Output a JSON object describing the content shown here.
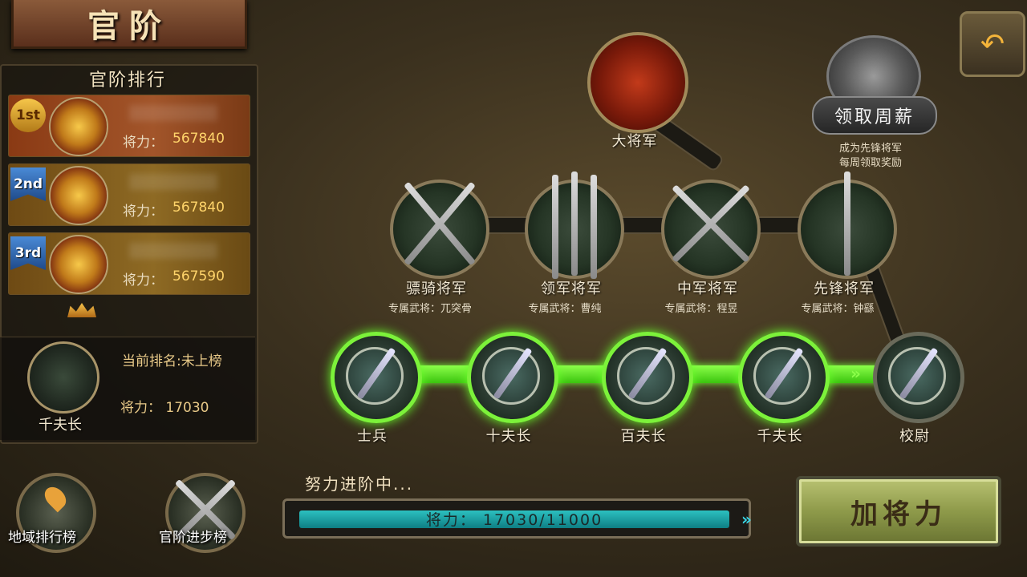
{
  "page_title": "官阶",
  "ranking": {
    "header": "官阶排行",
    "power_label": "将力：",
    "rows": [
      {
        "badge": "1st",
        "power": "567840"
      },
      {
        "badge": "2nd",
        "power": "567840"
      },
      {
        "badge": "3rd",
        "power": "567590"
      }
    ]
  },
  "current": {
    "rank_text": "当前排名:未上榜",
    "power_text": "将力：  17030",
    "title": "千夫长"
  },
  "weekly": {
    "button": "领取周薪",
    "desc1": "成为先锋将军",
    "desc2": "每周领取奖励"
  },
  "ranks": {
    "top": "大将军",
    "mid": [
      {
        "name": "骠骑将军",
        "hero": "专属武将：兀突骨"
      },
      {
        "name": "领军将军",
        "hero": "专属武将：曹纯"
      },
      {
        "name": "中军将军",
        "hero": "专属武将：程昱"
      },
      {
        "name": "先锋将军",
        "hero": "专属武将：钟繇"
      }
    ],
    "low": [
      "士兵",
      "十夫长",
      "百夫长",
      "千夫长",
      "校尉"
    ]
  },
  "bottom": {
    "region_rank": "地域排行榜",
    "rank_progress": "官阶进步榜",
    "progress_label": "努力进阶中...",
    "progress_text": "将力： 17030/11000",
    "progress_fraction": 1.0,
    "add_power": "加将力"
  },
  "icons": {
    "back": "back-arrow-icon",
    "chest": "treasure-chest-icon"
  },
  "colors": {
    "track": "#6fe82a",
    "progress": "#1fa8ae",
    "accent": "#ffd46a"
  }
}
